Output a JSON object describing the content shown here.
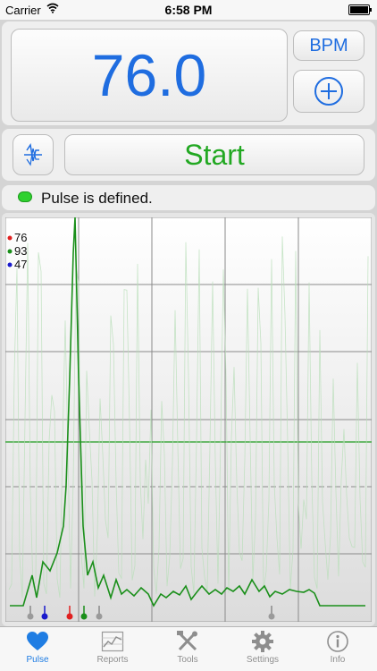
{
  "status_bar": {
    "carrier": "Carrier",
    "time": "6:58 PM"
  },
  "display": {
    "bpm_value": "76.0",
    "unit_button": "BPM"
  },
  "controls": {
    "start_label": "Start"
  },
  "status": {
    "message": "Pulse is defined.",
    "indicator_color": "#2fd12f"
  },
  "legend": [
    {
      "value": "76",
      "color": "#e02020"
    },
    {
      "value": "93",
      "color": "#1a8f1a"
    },
    {
      "value": "47",
      "color": "#1a1acc"
    }
  ],
  "tabs": [
    {
      "label": "Pulse",
      "icon": "heart-icon",
      "active": true
    },
    {
      "label": "Reports",
      "icon": "chart-icon",
      "active": false
    },
    {
      "label": "Tools",
      "icon": "tools-icon",
      "active": false
    },
    {
      "label": "Settings",
      "icon": "gear-icon",
      "active": false
    },
    {
      "label": "Info",
      "icon": "info-icon",
      "active": false
    }
  ]
}
